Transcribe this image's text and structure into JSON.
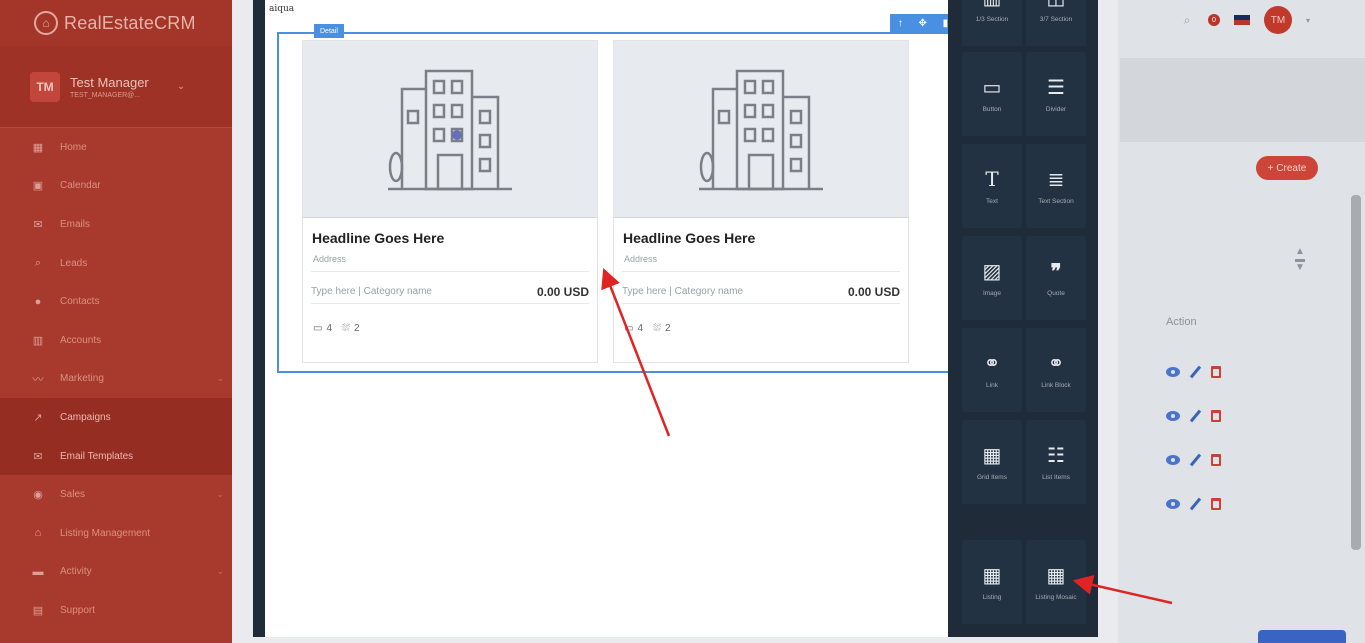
{
  "sidebar": {
    "brand": "RealEstateCRM",
    "user": {
      "initials": "TM",
      "name": "Test Manager",
      "role": "TEST_MANAGER@..."
    },
    "items": [
      {
        "label": "Home",
        "icon": "grid-icon"
      },
      {
        "label": "Calendar",
        "icon": "calendar-icon"
      },
      {
        "label": "Emails",
        "icon": "mail-icon"
      },
      {
        "label": "Leads",
        "icon": "search-icon"
      },
      {
        "label": "Contacts",
        "icon": "contact-icon"
      },
      {
        "label": "Accounts",
        "icon": "building-icon"
      },
      {
        "label": "Marketing",
        "icon": "chart-line-icon"
      },
      {
        "label": "Campaigns",
        "icon": "trend-icon"
      },
      {
        "label": "Email Templates",
        "icon": "mail-icon"
      },
      {
        "label": "Sales",
        "icon": "target-icon"
      },
      {
        "label": "Listing Management",
        "icon": "home-icon"
      },
      {
        "label": "Activity",
        "icon": "briefcase-icon"
      },
      {
        "label": "Support",
        "icon": "support-icon"
      }
    ]
  },
  "topbar": {
    "notification_count": "0",
    "avatar_initials": "TM"
  },
  "page": {
    "create_label": "+ Create",
    "action_header": "Action"
  },
  "editor": {
    "canvas_label": "aiqua",
    "selection_tag": "Detail",
    "cards": [
      {
        "title": "Headline Goes Here",
        "address": "Address",
        "type": "Type here | Category name",
        "price": "0.00 USD",
        "beds": "4",
        "baths": "2"
      },
      {
        "title": "Headline Goes Here",
        "address": "Address",
        "type": "Type here | Category name",
        "price": "0.00 USD",
        "beds": "4",
        "baths": "2"
      }
    ]
  },
  "blocks": [
    {
      "label": "1/3 Section",
      "icon": "three-column-icon"
    },
    {
      "label": "3/7 Section",
      "icon": "two-column-icon"
    },
    {
      "label": "Button",
      "icon": "button-icon"
    },
    {
      "label": "Divider",
      "icon": "divider-icon"
    },
    {
      "label": "Text",
      "icon": "text-icon"
    },
    {
      "label": "Text Section",
      "icon": "text-section-icon"
    },
    {
      "label": "Image",
      "icon": "image-icon"
    },
    {
      "label": "Quote",
      "icon": "quote-icon"
    },
    {
      "label": "Link",
      "icon": "link-icon"
    },
    {
      "label": "Link Block",
      "icon": "link-block-icon"
    },
    {
      "label": "Grid Items",
      "icon": "grid-items-icon"
    },
    {
      "label": "List Items",
      "icon": "list-items-icon"
    },
    {
      "label": "Listing",
      "icon": "listing-icon"
    },
    {
      "label": "Listing Mosaic",
      "icon": "listing-mosaic-icon"
    }
  ]
}
